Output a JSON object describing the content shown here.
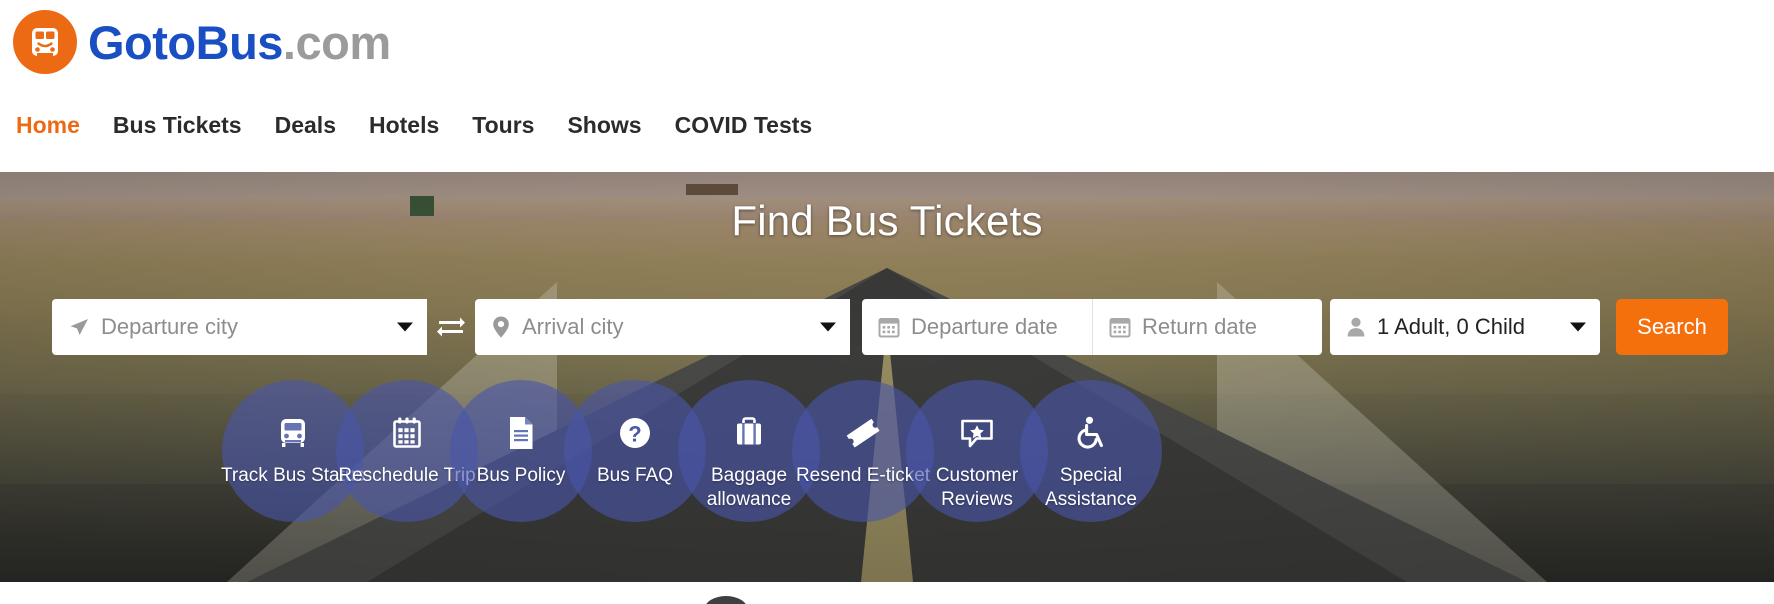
{
  "brand": {
    "name_primary": "GotoBus",
    "name_suffix": ".com",
    "logo_icon": "bus-logo-icon",
    "logo_color": "#ED6A15",
    "brand_color": "#1A4FC4",
    "suffix_color": "#9B9B9B"
  },
  "nav": {
    "items": [
      {
        "label": "Home",
        "active": true
      },
      {
        "label": "Bus Tickets",
        "active": false
      },
      {
        "label": "Deals",
        "active": false
      },
      {
        "label": "Hotels",
        "active": false
      },
      {
        "label": "Tours",
        "active": false
      },
      {
        "label": "Shows",
        "active": false
      },
      {
        "label": "COVID Tests",
        "active": false
      }
    ],
    "active_color": "#ED6A15",
    "color": "#2B2B2B"
  },
  "hero": {
    "title": "Find Bus Tickets"
  },
  "search": {
    "departure_city": {
      "placeholder": "Departure city",
      "value": "",
      "icon": "paper-plane-icon"
    },
    "arrival_city": {
      "placeholder": "Arrival city",
      "value": "",
      "icon": "map-pin-icon"
    },
    "departure_date": {
      "placeholder": "Departure date",
      "value": "",
      "icon": "calendar-icon"
    },
    "return_date": {
      "placeholder": "Return date",
      "value": "",
      "icon": "calendar-icon"
    },
    "passengers": {
      "value": "1 Adult, 0 Child",
      "icon": "person-icon"
    },
    "swap_icon": "swap-arrows-icon",
    "submit_label": "Search",
    "submit_color": "#F4700D"
  },
  "quicklinks": {
    "items": [
      {
        "label": "Track Bus Status",
        "icon": "bus-icon"
      },
      {
        "label": "Reschedule Trip",
        "icon": "calendar-icon"
      },
      {
        "label": "Bus Policy",
        "icon": "document-icon"
      },
      {
        "label": "Bus FAQ",
        "icon": "question-circle-icon"
      },
      {
        "label": "Baggage allowance",
        "icon": "suitcase-icon"
      },
      {
        "label": "Resend E-ticket",
        "icon": "ticket-icon"
      },
      {
        "label": "Customer Reviews",
        "icon": "review-star-icon"
      },
      {
        "label": "Special Assistance",
        "icon": "wheelchair-icon"
      }
    ],
    "circle_color": "rgba(72,86,170,0.62)"
  }
}
